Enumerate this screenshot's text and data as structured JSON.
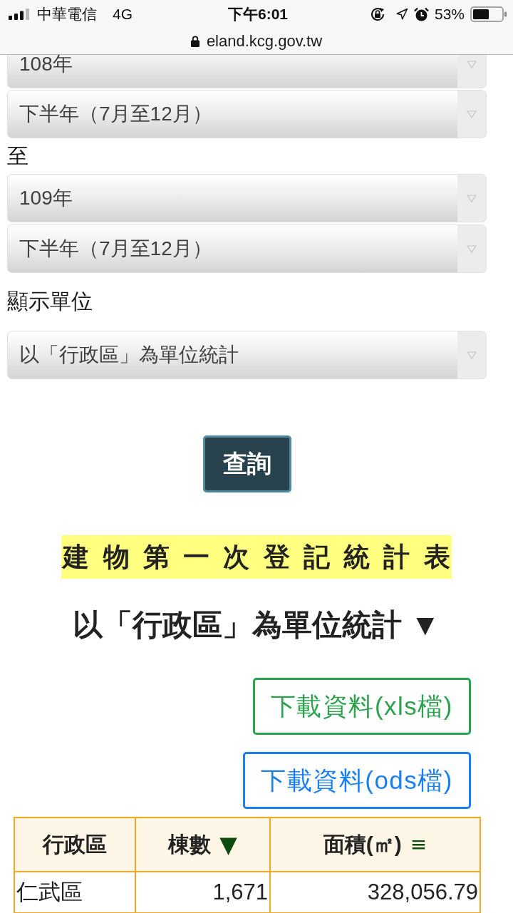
{
  "status_bar": {
    "carrier": "中華電信",
    "network": "4G",
    "time": "下午6:01",
    "battery": "53%"
  },
  "address_bar": {
    "url": "eland.kcg.gov.tw"
  },
  "form": {
    "from": [
      {
        "value": "108年"
      },
      {
        "value": "下半年（7月至12月）"
      }
    ],
    "to_label": "至",
    "to": [
      {
        "value": "109年"
      },
      {
        "value": "下半年（7月至12月）"
      }
    ],
    "unit_label": "顯示單位",
    "unit": {
      "value": "以「行政區」為單位統計"
    },
    "submit": "查詢"
  },
  "report": {
    "title": "建 物 第 一 次 登 記 統 計 表",
    "subtitle": "以「行政區」為單位統計 ▼",
    "downloads": [
      {
        "label": "下載資料(xls檔)",
        "color": "#2ba24c"
      },
      {
        "label": "下載資料(ods檔)",
        "color": "#1a7ff2"
      }
    ]
  },
  "table": {
    "columns": [
      {
        "label": "行政區"
      },
      {
        "label": "棟數",
        "sort_marker": "▼"
      },
      {
        "label": "面積(㎡)",
        "sort_marker": "≡"
      }
    ],
    "rows": [
      [
        "仁武區",
        "1,671",
        "328,056.79"
      ]
    ]
  }
}
